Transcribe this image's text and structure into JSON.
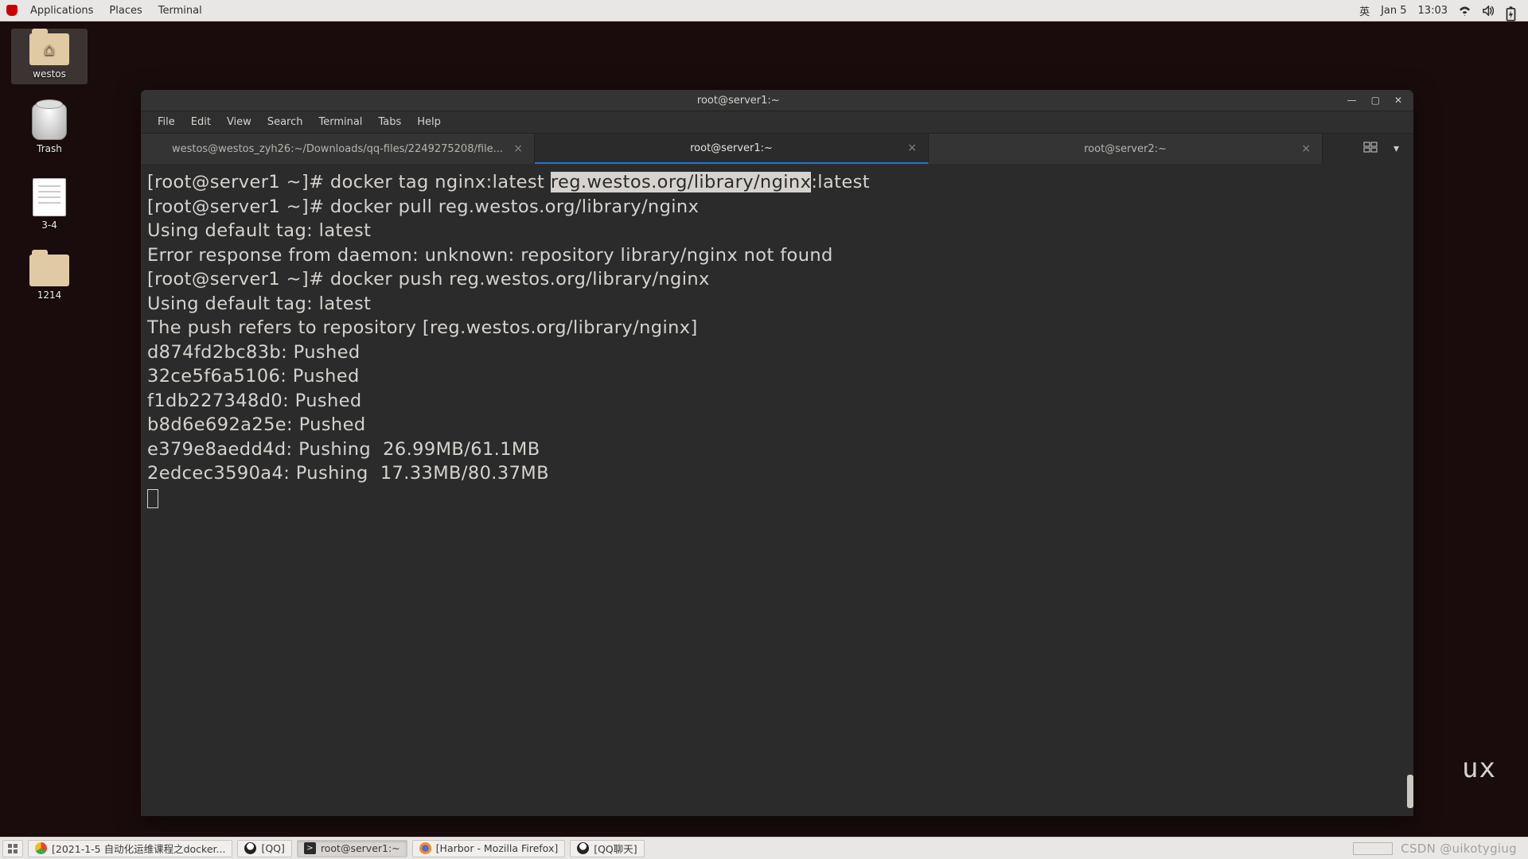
{
  "topbar": {
    "menus": [
      "Applications",
      "Places",
      "Terminal"
    ],
    "ime": "英",
    "date": "Jan 5",
    "time": "13:03"
  },
  "desktop": {
    "icons": [
      {
        "label": "westos",
        "type": "folder-home"
      },
      {
        "label": "Trash",
        "type": "trash"
      },
      {
        "label": "3-4",
        "type": "doc"
      },
      {
        "label": "1214",
        "type": "folder"
      }
    ]
  },
  "termwin": {
    "title": "root@server1:~",
    "menus": [
      "File",
      "Edit",
      "View",
      "Search",
      "Terminal",
      "Tabs",
      "Help"
    ],
    "tabs": [
      {
        "label": "westos@westos_zyh26:~/Downloads/qq-files/2249275208/file...",
        "active": false
      },
      {
        "label": "root@server1:~",
        "active": true
      },
      {
        "label": "root@server2:~",
        "active": false
      }
    ],
    "prompt1": "[root@server1 ~]# ",
    "cmd1a": "docker tag nginx:latest ",
    "cmd1_highlight": "reg.westos.org/library/nginx",
    "cmd1b": ":latest",
    "line2": "[root@server1 ~]# docker pull reg.westos.org/library/nginx",
    "line3": "Using default tag: latest",
    "line4": "Error response from daemon: unknown: repository library/nginx not found",
    "line5": "[root@server1 ~]# docker push reg.westos.org/library/nginx",
    "line6": "Using default tag: latest",
    "line7": "The push refers to repository [reg.westos.org/library/nginx]",
    "line8": "d874fd2bc83b: Pushed ",
    "line9": "32ce5f6a5106: Pushed ",
    "line10": "f1db227348d0: Pushed ",
    "line11": "b8d6e692a25e: Pushed ",
    "line12": "e379e8aedd4d: Pushing  26.99MB/61.1MB",
    "line13": "2edcec3590a4: Pushing  17.33MB/80.37MB"
  },
  "taskbar": {
    "items": [
      {
        "icon": "chrome",
        "label": "[2021-1-5 自动化运维课程之docker...",
        "active": false
      },
      {
        "icon": "penguin",
        "label": "[QQ]",
        "active": false
      },
      {
        "icon": "term",
        "label": "root@server1:~",
        "active": true
      },
      {
        "icon": "ff",
        "label": "[Harbor - Mozilla Firefox]",
        "active": false
      },
      {
        "icon": "penguin",
        "label": "[QQ聊天]",
        "active": false
      }
    ],
    "watermark": "CSDN @uikotygiug"
  },
  "uxtag": "ux"
}
